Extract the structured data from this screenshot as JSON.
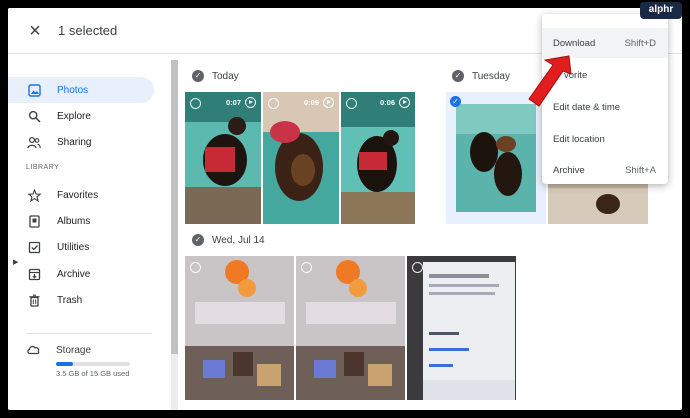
{
  "header": {
    "close_icon": "×",
    "selection_text": "1 selected"
  },
  "sidebar": {
    "items": [
      {
        "label": "Photos",
        "icon": "image-icon"
      },
      {
        "label": "Explore",
        "icon": "search-icon"
      },
      {
        "label": "Sharing",
        "icon": "people-icon"
      }
    ],
    "library_label": "LIBRARY",
    "library_items": [
      {
        "label": "Favorites",
        "icon": "star-icon"
      },
      {
        "label": "Albums",
        "icon": "album-icon"
      },
      {
        "label": "Utilities",
        "icon": "checkbox-icon"
      },
      {
        "label": "Archive",
        "icon": "archive-icon"
      },
      {
        "label": "Trash",
        "icon": "trash-icon"
      }
    ],
    "storage": {
      "label": "Storage",
      "usage_text": "3.5 GB of 15 GB used",
      "used_fraction": 0.23
    }
  },
  "sections": {
    "today": {
      "label": "Today",
      "durations": [
        "0:07",
        "0:09",
        "0:06"
      ]
    },
    "tuesday": {
      "label": "Tuesday"
    },
    "wed": {
      "label": "Wed, Jul 14"
    }
  },
  "menu": {
    "items": [
      {
        "label": "Download",
        "shortcut": "Shift+D"
      },
      {
        "label": "vorite",
        "shortcut": ""
      },
      {
        "label": "Edit date & time",
        "shortcut": ""
      },
      {
        "label": "Edit location",
        "shortcut": ""
      },
      {
        "label": "Archive",
        "shortcut": "Shift+A"
      }
    ]
  },
  "watermark": "alphr",
  "colors": {
    "accent": "#1a73e8",
    "arrow": "#e11d1d",
    "selected_bg": "#e8f0fe"
  }
}
